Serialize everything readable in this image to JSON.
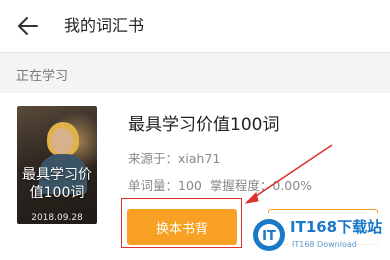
{
  "header": {
    "back_icon": "arrow-left-icon",
    "title": "我的词汇书"
  },
  "section": {
    "label": "正在学习"
  },
  "book": {
    "cover_title": "最具学习价值100词",
    "cover_date": "2018.09.28",
    "title": "最具学习价值100词",
    "source": "来源于：xiah71",
    "word_count": "单词量：100",
    "mastery": "掌握程度：0.00%",
    "change_button_label": "换本书背",
    "second_button_label": ""
  },
  "annotation": {
    "color": "#e0312a"
  },
  "watermark": {
    "main": "IT168下载站",
    "sub": "IT168 Download"
  },
  "colors": {
    "accent": "#f7a023",
    "annotation": "#e0312a",
    "watermark": "#1a78c8"
  }
}
